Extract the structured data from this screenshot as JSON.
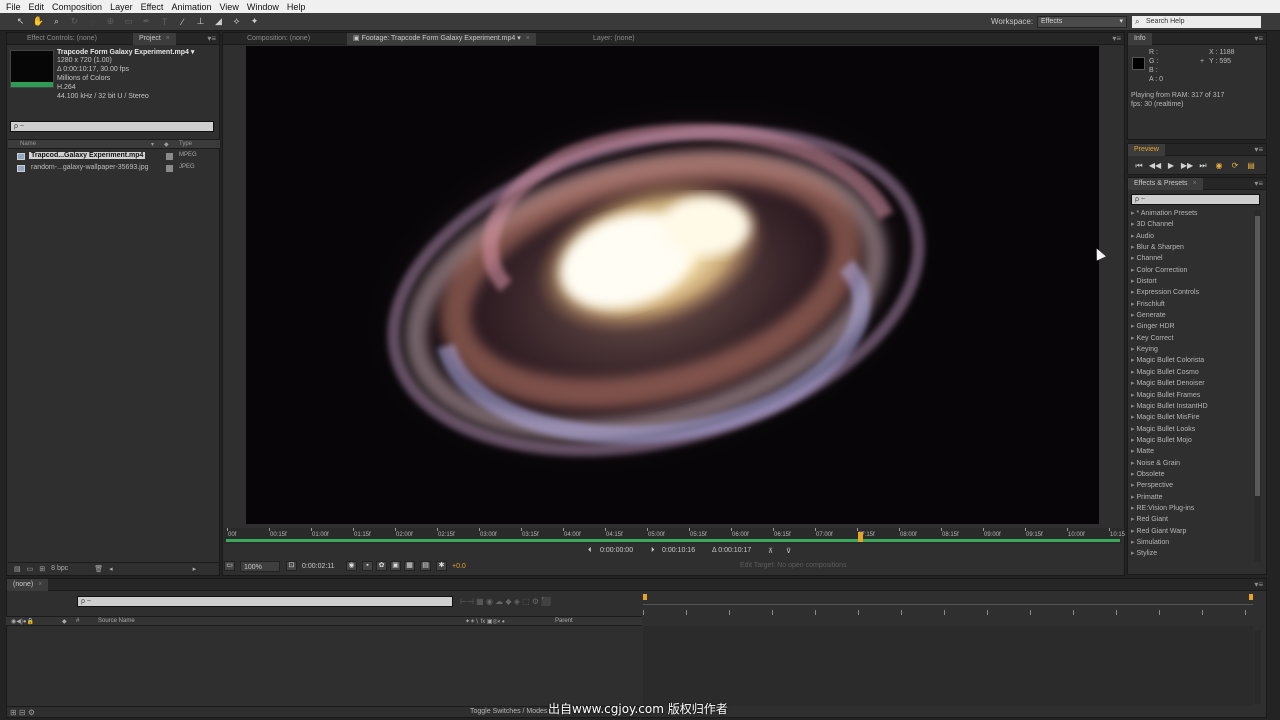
{
  "menu": [
    "File",
    "Edit",
    "Composition",
    "Layer",
    "Effect",
    "Animation",
    "View",
    "Window",
    "Help"
  ],
  "toolbar": {
    "icons": [
      "selection-tool",
      "hand-tool",
      "zoom-tool",
      "rotate-tool",
      "orbit-tool",
      "pan-behind-tool",
      "mask-tool",
      "pen-tool",
      "type-tool",
      "brush-tool",
      "clone-tool",
      "eraser-tool",
      "roto-tool",
      "puppet-tool"
    ],
    "workspace_label": "Workspace:",
    "workspace_value": "Effects",
    "search_help": "Search Help"
  },
  "project_panel": {
    "tabs": [
      "Effect Controls: (none)",
      "Project"
    ],
    "footage_name": "Trapcode Form Galaxy Experiment.mp4 ▾",
    "footage_size": "1280 x 720 (1.00)",
    "footage_duration": "Δ 0:00:10:17, 30.00 fps",
    "footage_colors": "Millions of Colors",
    "footage_codec": "H.264",
    "footage_audio": "44.100 kHz / 32 bit U / Stereo",
    "search_placeholder": "ρ ~",
    "col_name": "Name",
    "col_type": "Type",
    "items": [
      {
        "name": "Trapcod...Galaxy Experiment.mp4",
        "type": "MPEG",
        "selected": true
      },
      {
        "name": "random-...galaxy-wallpaper-35693.jpg",
        "type": "JPEG",
        "selected": false
      }
    ],
    "bpc": "8 bpc"
  },
  "viewer_tabs": [
    "Composition: (none)",
    "Footage: Trapcode Form Galaxy Experiment.mp4",
    "Layer: (none)"
  ],
  "viewer": {
    "timecodes": [
      "00f",
      "00:15f",
      "01:00f",
      "01:15f",
      "02:00f",
      "02:15f",
      "03:00f",
      "03:15f",
      "04:00f",
      "04:15f",
      "05:00f",
      "05:15f",
      "06:00f",
      "06:15f",
      "07:00f",
      "07:15f",
      "08:00f",
      "08:15f",
      "09:00f",
      "09:15f",
      "10:00f",
      "10:15"
    ],
    "in_point": "0:00:00:00",
    "out_point": "0:00:10:16",
    "duration": "Δ 0:00:10:17",
    "zoom": "100%",
    "current_time": "0:00:02:11",
    "exposure": "+0.0",
    "edit_target": "Edit Target: No open compositions"
  },
  "info_panel": {
    "title": "Info",
    "r": "R :",
    "g": "G :",
    "b": "B :",
    "a": "A : 0",
    "x": "X : 1188",
    "y": "Y : 595",
    "status1": "Playing from RAM: 317 of 317",
    "status2": "fps: 30 (realtime)"
  },
  "preview_panel": {
    "title": "Preview",
    "buttons": [
      "⏮",
      "◀◀",
      "▶",
      "▶▶",
      "⏭",
      "◉",
      "⟳",
      "▤"
    ]
  },
  "effects_panel": {
    "title": "Effects & Presets",
    "search_placeholder": "ρ ~",
    "items": [
      "* Animation Presets",
      "3D Channel",
      "Audio",
      "Blur & Sharpen",
      "Channel",
      "Color Correction",
      "Distort",
      "Expression Controls",
      "Frischluft",
      "Generate",
      "Ginger HDR",
      "Key Correct",
      "Keying",
      "Magic Bullet Colorista",
      "Magic Bullet Cosmo",
      "Magic Bullet Denoiser",
      "Magic Bullet Frames",
      "Magic Bullet InstantHD",
      "Magic Bullet MisFire",
      "Magic Bullet Looks",
      "Magic Bullet Mojo",
      "Matte",
      "Noise & Grain",
      "Obsolete",
      "Perspective",
      "Primatte",
      "RE:Vision Plug-ins",
      "Red Giant",
      "Red Giant Warp",
      "Simulation",
      "Stylize"
    ]
  },
  "timeline": {
    "tab": "(none)",
    "search_placeholder": "ρ ~",
    "source_name": "Source Name",
    "parent": "Parent",
    "toggle": "Toggle Switches / Modes"
  },
  "watermark": "出自www.cgjoy.com 版权归作者",
  "colors": {
    "accent": "#e6a22a",
    "green": "#39a85a",
    "panel": "#2f2f2f"
  }
}
